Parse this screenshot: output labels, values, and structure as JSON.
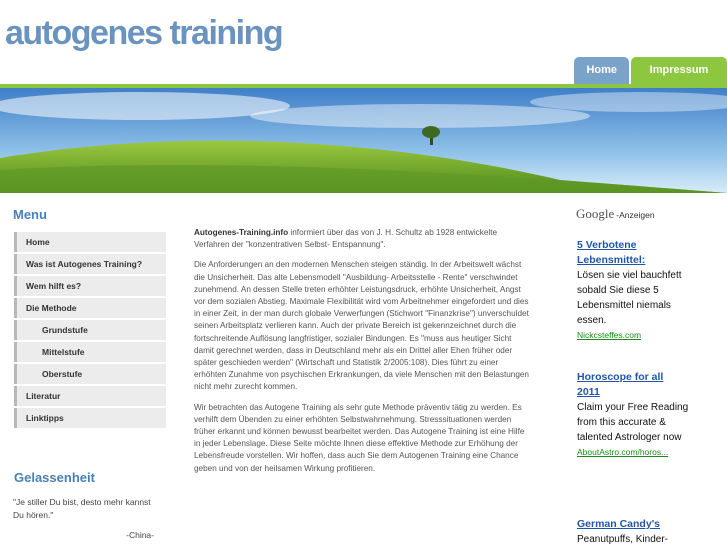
{
  "site": {
    "title": "autogenes training"
  },
  "tabs": [
    {
      "label": "Home"
    },
    {
      "label": "Impressum"
    }
  ],
  "menu": {
    "title": "Menu",
    "items": [
      {
        "label": "Home"
      },
      {
        "label": "Was ist Autogenes Training?"
      },
      {
        "label": "Wem hilft es?"
      },
      {
        "label": "Die Methode"
      },
      {
        "label": "Grundstufe"
      },
      {
        "label": "Mittelstufe"
      },
      {
        "label": "Oberstufe"
      },
      {
        "label": "Literatur"
      },
      {
        "label": "Linktipps"
      }
    ]
  },
  "sidebar_quote": {
    "title": "Gelassenheit",
    "text": "\"Je stiller Du bist, desto mehr kannst Du hören.\"",
    "source": "-China-"
  },
  "content": {
    "intro_bold": "Autogenes-Training.info",
    "intro_rest": " informiert über das von J. H. Schultz ab 1928 entwickelte Verfahren der \"konzentrativen Selbst- Entspannung\".",
    "para2": "Die Anforderungen an den modernen Menschen steigen ständig. In der Arbeitswelt wächst die Unsicherheit. Das alte Lebensmodell \"Ausbildung- Arbeitsstelle - Rente\" verschwindet zunehmend. An dessen Stelle treten erhöhter Leistungsdruck, erhöhte Unsicherheit, Angst vor dem sozialen Abstieg. Maximale Flexibilität wird vom Arbeitnehmer eingefordert und dies in einer Zeit, in der man durch globale Verwerfungen (Stichwort \"Finanzkrise\") unverschuldet seinen Arbeitsplatz verlieren kann. Auch der private Bereich ist gekennzeichnet durch die fortschreitende Auflösung langfristiger, sozialer Bindungen. Es \"muss aus heutiger Sicht damit gerechnet werden, dass in Deutschland mehr als ein Drittel aller Ehen früher oder später geschieden werden\" (Wirtschaft und Statistik 2/2005:108). Dies führt zu einer erhöhten Zunahme von psychischen Erkrankungen, da viele Menschen mit den Belastungen nicht mehr zurecht kommen.",
    "para3": "Wir betrachten das Autogene Training als sehr gute Methode präventiv tätig zu werden. Es verhilft dem Übenden zu einer erhöhten Selbstwahrnehmung. Stresssituationen werden früher erkannt und können bewusst bearbeitet werden. Das Autogene Training ist eine Hilfe in jeder Lebenslage. Diese Seite möchte Ihnen diese effektive Methode zur Erhöhung der Lebensfreude vorstellen. Wir hoffen, dass auch Sie dem Autogenen Training eine Chance geben und von der heilsamen Wirkung profitieren."
  },
  "ads": {
    "logo": "Google",
    "label": "-Anzeigen",
    "items": [
      {
        "title": "5 Verbotene Lebensmittel:",
        "body": "Lösen sie viel bauchfett sobald Sie diese 5 Lebensmittel niemals essen.",
        "url": "Nickcsteffes.com"
      },
      {
        "title": "Horoscope for all 2011",
        "body": "Claim your Free Reading from this accurate & talented Astrologer now",
        "url": "AboutAstro.com/horos..."
      },
      {
        "title": "German Candy's",
        "body": "Peanutpuffs, Kinder-",
        "url": ""
      }
    ]
  },
  "colors": {
    "accent_blue": "#6a93c0",
    "accent_green": "#8dc63f",
    "link_blue": "#2255aa",
    "url_green": "#1a8a1a"
  }
}
